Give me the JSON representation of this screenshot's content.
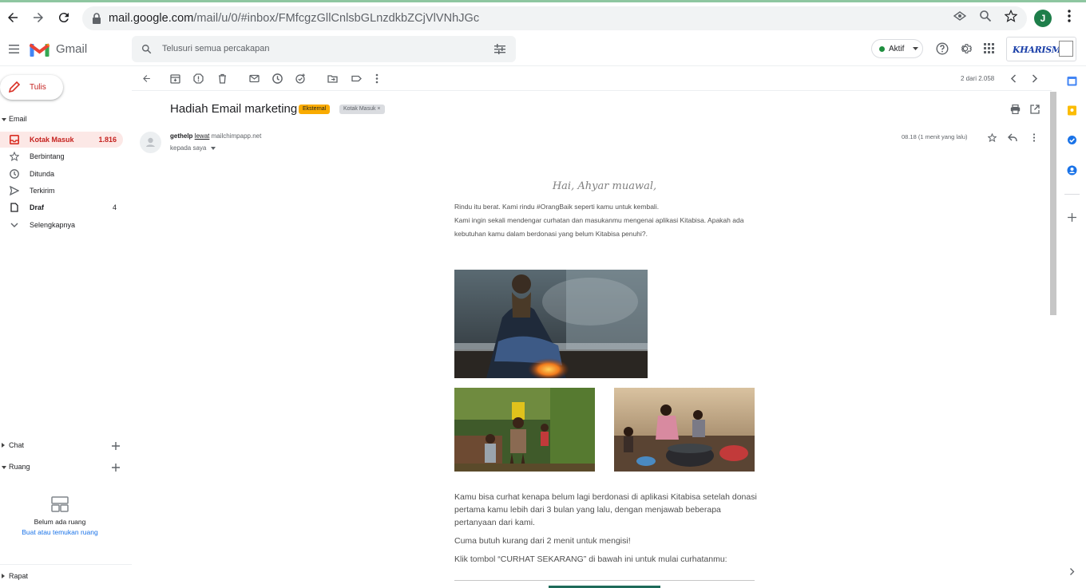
{
  "browser": {
    "url_host": "mail.google.com",
    "url_path": "/mail/u/0/#inbox/FMfcgzGllCnlsbGLnzdkbZCjVlVNhJGc",
    "profile_initial": "J"
  },
  "header": {
    "app_name": "Gmail",
    "search_placeholder": "Telusuri semua percakapan",
    "status_label": "Aktif",
    "brand_name": "KHARISMA"
  },
  "compose": {
    "label": "Tulis"
  },
  "nav": {
    "section_label": "Email",
    "items": [
      {
        "label": "Kotak Masuk",
        "count": "1.816",
        "icon": "inbox-icon"
      },
      {
        "label": "Berbintang",
        "count": "",
        "icon": "star-icon"
      },
      {
        "label": "Ditunda",
        "count": "",
        "icon": "clock-icon"
      },
      {
        "label": "Terkirim",
        "count": "",
        "icon": "send-icon"
      },
      {
        "label": "Draf",
        "count": "4",
        "icon": "draft-icon"
      },
      {
        "label": "Selengkapnya",
        "count": "",
        "icon": "chevron-down-icon"
      }
    ],
    "chat_label": "Chat",
    "rooms_label": "Ruang",
    "empty_rooms_text": "Belum ada ruang",
    "empty_rooms_link": "Buat atau temukan ruang",
    "meet_label": "Rapat"
  },
  "toolbar": {
    "pager_text": "2 dari 2.058"
  },
  "email": {
    "subject": "Hadiah Email marketing",
    "badge_external": "Eksternal",
    "badge_inbox": "Kotak Masuk",
    "sender_name": "gethelp",
    "via_label": "lewat",
    "via_domain": "mailchimpapp.net",
    "to_label": "kepada saya",
    "time": "08.18 (1 menit yang lalu)",
    "greeting": "Hai, Ahyar muawal,",
    "intro_line1": "Rindu itu berat. Kami rindu #OrangBaik seperti kamu untuk kembali.",
    "intro_line2": "Kami ingin sekali mendengar curhatan dan masukanmu mengenai aplikasi Kitabisa. Apakah ada kebutuhan kamu dalam berdonasi yang belum Kitabisa penuhi?.",
    "body_para1": "Kamu bisa curhat kenapa belum lagi berdonasi di aplikasi Kitabisa setelah donasi pertama kamu lebih dari 3 bulan yang lalu, dengan menjawab beberapa pertanyaan dari kami.",
    "body_para2": "Cuma butuh kurang dari 2 menit untuk mengisi!",
    "body_para3": "Klik tombol “CURHAT SEKARANG” di bawah ini untuk mulai curhatanmu:"
  },
  "colors": {
    "accent_red": "#c5221f",
    "badge_external": "#f9ab00",
    "badge_inbox": "#dadce0"
  }
}
